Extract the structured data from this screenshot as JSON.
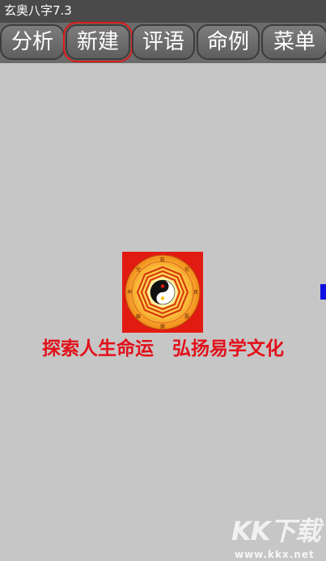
{
  "app": {
    "title": "玄奥八字7.3"
  },
  "toolbar": {
    "tabs": [
      {
        "label": "分析"
      },
      {
        "label": "新建"
      },
      {
        "label": "评语"
      },
      {
        "label": "命例"
      },
      {
        "label": "菜单"
      }
    ],
    "selected_tab": "新建"
  },
  "logo": {
    "icon": "bagua-taiji-icon",
    "trigram_labels": [
      "乾",
      "坎",
      "艮",
      "震",
      "巽",
      "離",
      "坤",
      "兌"
    ]
  },
  "slogan": {
    "text": "探索人生命运　弘扬易学文化"
  },
  "watermark": {
    "logo_text": "KK下载",
    "url": "www.kkx.net"
  },
  "colors": {
    "background": "#c6c6c6",
    "titlebar": "#4a4a4a",
    "toolbar": "#6b6b6b",
    "selected_outline": "#e01818",
    "slogan": "#e3101a",
    "logo_background": "#e21b12",
    "side_marker": "#1010e0"
  }
}
